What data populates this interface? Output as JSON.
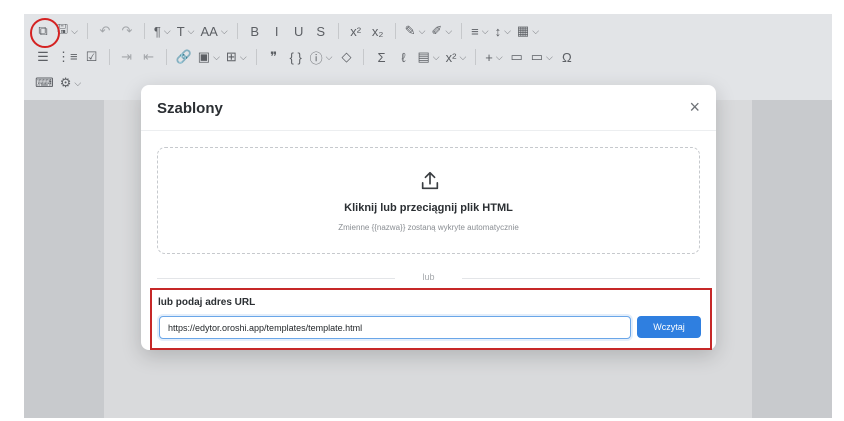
{
  "toolbar": {
    "row1": [
      {
        "name": "templates-icon",
        "glyph": "⧉"
      },
      {
        "name": "save-icon",
        "glyph": "🖫",
        "chevron": true
      },
      {
        "sep": true
      },
      {
        "name": "undo-icon",
        "glyph": "↶",
        "dim": true
      },
      {
        "name": "redo-icon",
        "glyph": "↷",
        "dim": true
      },
      {
        "sep": true
      },
      {
        "name": "paragraph-icon",
        "glyph": "¶",
        "chevron": true
      },
      {
        "name": "font-icon",
        "glyph": "T",
        "chevron": true
      },
      {
        "name": "font-size-icon",
        "glyph": "AA",
        "chevron": true
      },
      {
        "sep": true
      },
      {
        "name": "bold-icon",
        "glyph": "B"
      },
      {
        "name": "italic-icon",
        "glyph": "I"
      },
      {
        "name": "underline-icon",
        "glyph": "U"
      },
      {
        "name": "strikethrough-icon",
        "glyph": "S"
      },
      {
        "sep": true
      },
      {
        "name": "superscript-icon",
        "glyph": "x²"
      },
      {
        "name": "subscript-icon",
        "glyph": "x₂"
      },
      {
        "sep": true
      },
      {
        "name": "text-color-icon",
        "glyph": "✎",
        "chevron": true
      },
      {
        "name": "highlight-icon",
        "glyph": "✐",
        "chevron": true
      },
      {
        "sep": true
      },
      {
        "name": "align-icon",
        "glyph": "≡",
        "chevron": true
      },
      {
        "name": "line-height-icon",
        "glyph": "↕",
        "chevron": true
      },
      {
        "name": "grid-icon",
        "glyph": "▦",
        "chevron": true
      }
    ],
    "row2": [
      {
        "name": "bullet-list-icon",
        "glyph": "☰"
      },
      {
        "name": "numbered-list-icon",
        "glyph": "⋮≡"
      },
      {
        "name": "checklist-icon",
        "glyph": "☑"
      },
      {
        "sep": true
      },
      {
        "name": "indent-icon",
        "glyph": "⇥",
        "dim": true
      },
      {
        "name": "outdent-icon",
        "glyph": "⇤",
        "dim": true
      },
      {
        "sep": true
      },
      {
        "name": "link-icon",
        "glyph": "🔗"
      },
      {
        "name": "image-icon",
        "glyph": "▣",
        "chevron": true
      },
      {
        "name": "table-icon",
        "glyph": "⊞",
        "chevron": true
      },
      {
        "sep": true
      },
      {
        "name": "quote-icon",
        "glyph": "❞"
      },
      {
        "name": "code-icon",
        "glyph": "{ }"
      },
      {
        "name": "info-icon",
        "glyph": "ⓘ",
        "chevron": true
      },
      {
        "name": "diamond-icon",
        "glyph": "◇"
      },
      {
        "sep": true
      },
      {
        "name": "sigma-icon",
        "glyph": "Σ"
      },
      {
        "name": "formula-icon",
        "glyph": "ℓ"
      },
      {
        "name": "media-icon",
        "glyph": "▤",
        "chevron": true
      },
      {
        "name": "power-icon",
        "glyph": "x²",
        "chevron": true
      },
      {
        "sep": true
      },
      {
        "name": "add-icon",
        "glyph": "+",
        "chevron": true
      },
      {
        "name": "comment-icon",
        "glyph": "▭"
      },
      {
        "name": "field-icon",
        "glyph": "▭",
        "chevron": true
      },
      {
        "name": "omega-icon",
        "glyph": "Ω"
      }
    ],
    "row3": [
      {
        "name": "keyboard-icon",
        "glyph": "⌨"
      },
      {
        "name": "settings-icon",
        "glyph": "⚙",
        "chevron": true
      }
    ]
  },
  "modal": {
    "title": "Szablony",
    "close_glyph": "×",
    "dropzone": {
      "title": "Kliknij lub przeciągnij plik HTML",
      "hint": "Zmienne {{nazwa}} zostaną wykryte automatycznie"
    },
    "divider_text": "lub",
    "url": {
      "label": "lub podaj adres URL",
      "value": "https://edytor.oroshi.app/templates/template.html",
      "button_label": "Wczytaj"
    }
  },
  "colors": {
    "accent": "#2f7fe0",
    "highlight_red": "#d42222"
  }
}
